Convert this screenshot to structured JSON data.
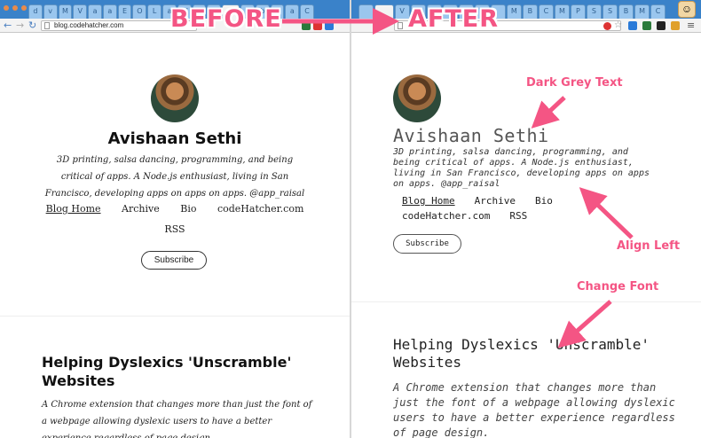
{
  "annotations": {
    "before": "BEFORE",
    "after": "AFTER",
    "dark_grey_text": "Dark Grey Text",
    "align_left": "Align Left",
    "change_font": "Change Font"
  },
  "browser": {
    "url": "blog.codehatcher.com",
    "right_url_partial": "b",
    "tab_glyphs_left": [
      "d",
      "v",
      "M",
      "V",
      "a",
      "a",
      "E",
      "O",
      "L",
      "a",
      "W",
      "C",
      "C",
      "",
      "a",
      "b",
      "",
      "a",
      "C"
    ],
    "tab_glyphs_right": [
      "",
      "",
      "V",
      "H",
      "a",
      "M",
      "",
      "T",
      "",
      "M",
      "B",
      "C",
      "M",
      "P",
      "S",
      "S",
      "B",
      "M",
      "C"
    ],
    "extension_colors": [
      "#d33",
      "#2a7ad8",
      "#2b7a3b",
      "#6e4fb0",
      "#e0a02b"
    ]
  },
  "left_page": {
    "name": "Avishaan Sethi",
    "bio": "3D printing, salsa dancing, programming, and being critical of apps. A Node.js enthusiast, living in San Francisco, developing apps on apps on apps. @app_raisal",
    "nav": [
      "Blog Home",
      "Archive",
      "Bio",
      "codeHatcher.com"
    ],
    "rss": "RSS",
    "subscribe": "Subscribe",
    "post_title": "Helping Dyslexics 'Unscramble' Websites",
    "post_excerpt": "A Chrome extension that changes more than just the font of a webpage allowing dyslexic users to have a better experience regardless of page design."
  },
  "right_page": {
    "name": "Avishaan Sethi",
    "bio": "3D printing, salsa dancing, programming, and being critical of apps. A Node.js enthusiast, living in San Francisco, developing apps on apps on apps. @app_raisal",
    "nav": [
      "Blog Home",
      "Archive",
      "Bio",
      "codeHatcher.com",
      "RSS"
    ],
    "subscribe": "Subscribe",
    "post_title": "Helping Dyslexics 'Unscramble' Websites",
    "post_excerpt": "A Chrome extension that changes more than just the font of a webpage allowing dyslexic users to have a better experience regardless of page design."
  },
  "colors": {
    "annotation_pink": "#f45584",
    "chrome_blue": "#3a82c9"
  }
}
